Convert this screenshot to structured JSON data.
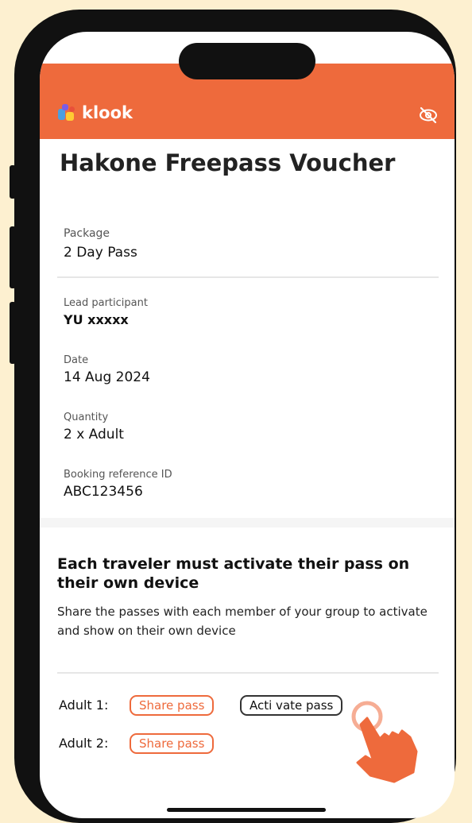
{
  "header": {
    "brand": "klook",
    "brand_color": "#ee6a3c",
    "visibility_icon": "eye-off-icon"
  },
  "voucher": {
    "title": "Hakone Freepass Voucher",
    "package_label": "Package",
    "package_value": "2 Day Pass",
    "lead_label": "Lead participant",
    "lead_value": "YU xxxxx",
    "date_label": "Date",
    "date_value": "14 Aug 2024",
    "quantity_label": "Quantity",
    "quantity_value": "2 x Adult",
    "booking_label": "Booking reference ID",
    "booking_value": "ABC123456"
  },
  "notice": {
    "title": "Each traveler must activate their pass on their own device",
    "text": "Share the passes with each member of your group to activate and show on their own device"
  },
  "travelers": [
    {
      "label": "Adult 1:",
      "share_label": "Share pass",
      "activate_label": "Acti vate pass"
    },
    {
      "label": "Adult 2:",
      "share_label": "Share pass"
    }
  ],
  "pointer_icon": "pointing-hand-icon"
}
